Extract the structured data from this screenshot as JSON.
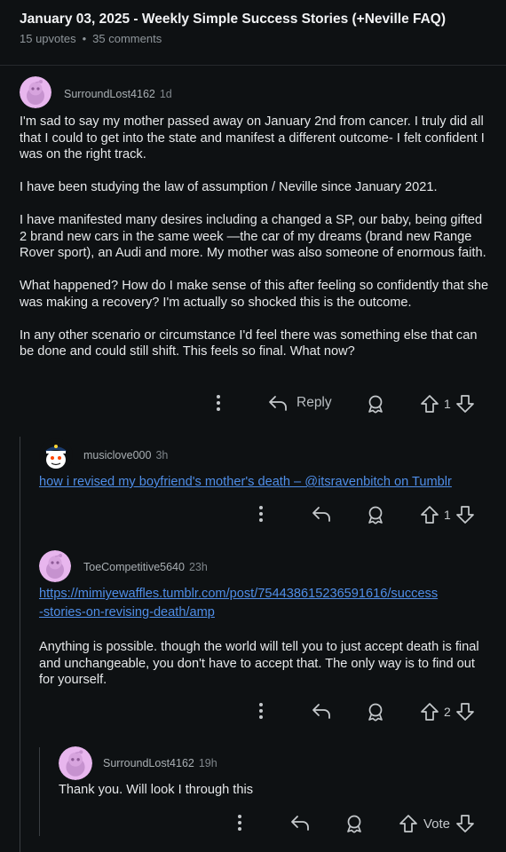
{
  "post": {
    "title": "January 03, 2025 - Weekly Simple Success Stories (+Neville FAQ)",
    "upvotes": "15 upvotes",
    "separator": "•",
    "comments": "35 comments"
  },
  "comments": [
    {
      "username": "SurroundLost4162",
      "age": "1d",
      "paragraphs": [
        "I'm sad to say my mother passed away on January 2nd from cancer. I truly did all that I could to get into the state and manifest a different outcome- I felt confident I was on the right track.",
        "I have been studying the law of assumption / Neville since January 2021.",
        "I have manifested many desires including a changed a SP, our baby, being gifted 2 brand new cars in the same week —the car of my dreams (brand new Range Rover sport), an Audi and more. My mother was also someone of enormous faith.",
        "What happened? How do I make sense of this after feeling so confidently that she was making a recovery? I'm actually so shocked this is the outcome.",
        "In any other scenario or circumstance I'd feel there was something else that can be done and could still shift. This feels so final. What now?"
      ],
      "reply_label": "Reply",
      "score": "1"
    },
    {
      "username": "musiclove000",
      "age": "3h",
      "link_text": "how i revised my boyfriend's mother's death – @itsravenbitch on Tumblr",
      "score": "1"
    },
    {
      "username": "ToeCompetitive5640",
      "age": "23h",
      "link_line1": "https://mimiyewaffles.tumblr.com/post/754438615236591616/success",
      "link_line2": "-stories-on-revising-death/amp",
      "text": "Anything is possible. though the world will tell you to just accept death is final and unchangeable, you don't have to accept that. The only way is to find out for yourself.",
      "score": "2"
    },
    {
      "username": "SurroundLost4162",
      "age": "19h",
      "text": "Thank you. Will look I through this",
      "score": "Vote"
    }
  ],
  "colors": {
    "background": "#0e1113",
    "link": "#4f8ee8",
    "avatar_pink": "#e8b6ee"
  }
}
